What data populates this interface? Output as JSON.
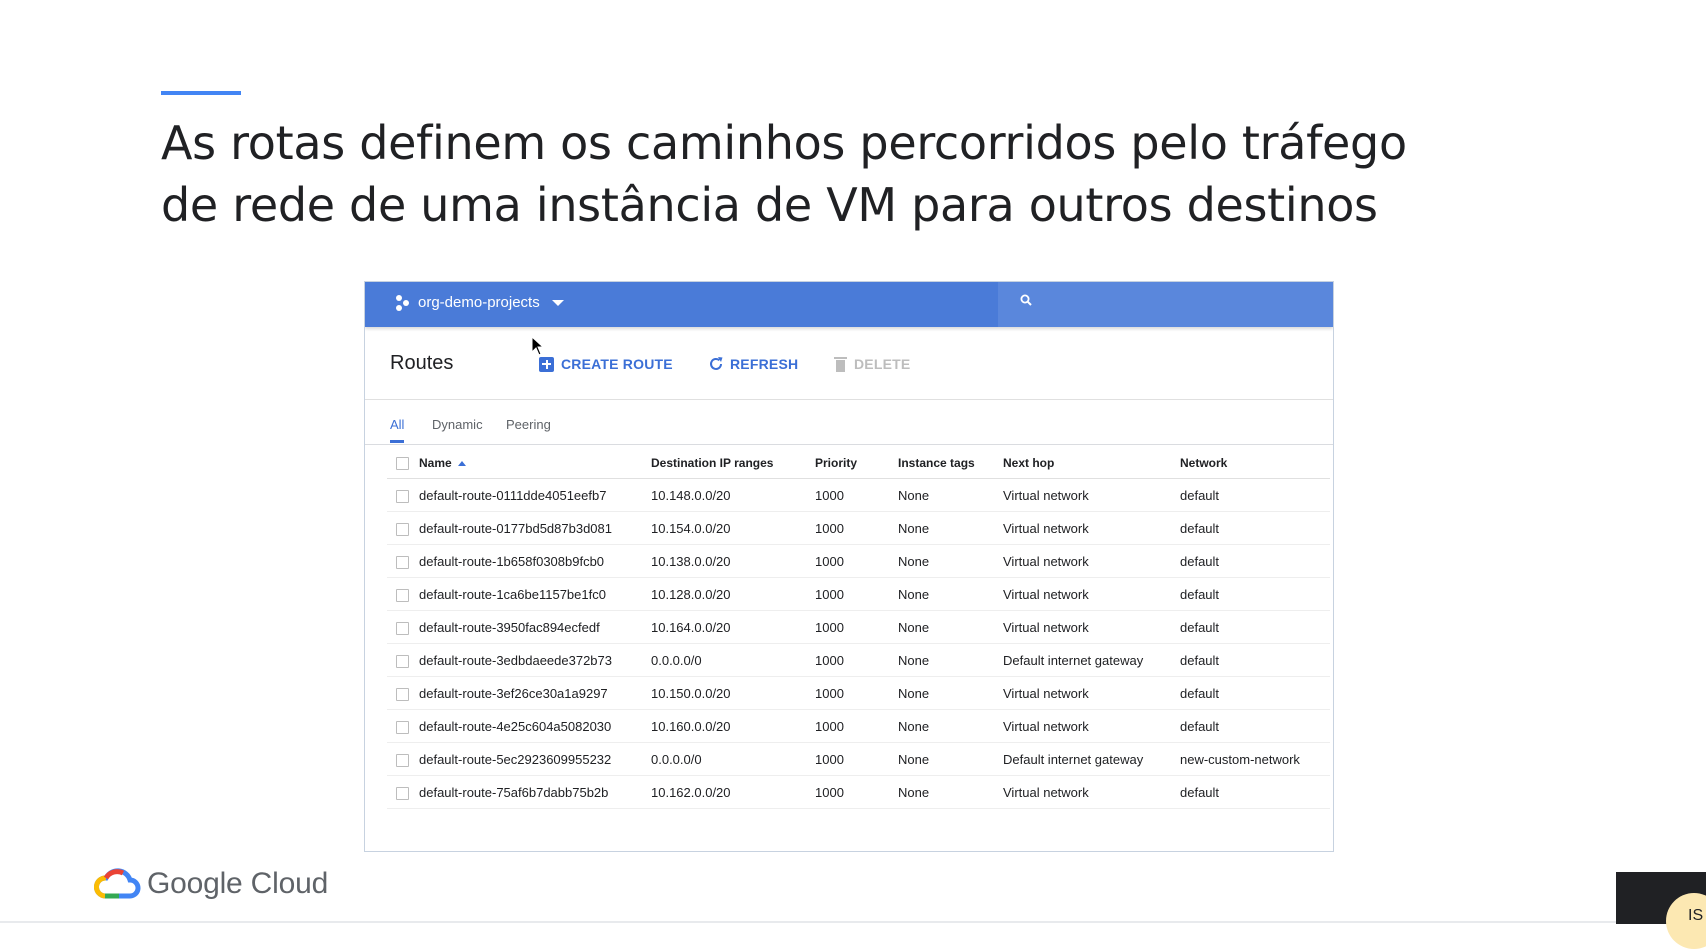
{
  "slide": {
    "title_line1": "As rotas definem os caminhos percorridos pelo tráfego",
    "title_line2": "de rede de uma instância de VM para outros destinos",
    "accent_color": "#4285f4"
  },
  "console": {
    "project_name": "org-demo-projects",
    "header_color": "#4a7bd8",
    "page_title": "Routes",
    "toolbar": {
      "create_label": "CREATE ROUTE",
      "refresh_label": "REFRESH",
      "delete_label": "DELETE"
    },
    "tabs": [
      "All",
      "Dynamic",
      "Peering"
    ],
    "active_tab": "All",
    "columns": [
      "Name",
      "Destination IP ranges",
      "Priority",
      "Instance tags",
      "Next hop",
      "Network"
    ],
    "rows": [
      {
        "name": "default-route-0111dde4051eefb7",
        "dest": "10.148.0.0/20",
        "priority": "1000",
        "tags": "None",
        "hop": "Virtual network",
        "network": "default"
      },
      {
        "name": "default-route-0177bd5d87b3d081",
        "dest": "10.154.0.0/20",
        "priority": "1000",
        "tags": "None",
        "hop": "Virtual network",
        "network": "default"
      },
      {
        "name": "default-route-1b658f0308b9fcb0",
        "dest": "10.138.0.0/20",
        "priority": "1000",
        "tags": "None",
        "hop": "Virtual network",
        "network": "default"
      },
      {
        "name": "default-route-1ca6be1157be1fc0",
        "dest": "10.128.0.0/20",
        "priority": "1000",
        "tags": "None",
        "hop": "Virtual network",
        "network": "default"
      },
      {
        "name": "default-route-3950fac894ecfedf",
        "dest": "10.164.0.0/20",
        "priority": "1000",
        "tags": "None",
        "hop": "Virtual network",
        "network": "default"
      },
      {
        "name": "default-route-3edbdaeede372b73",
        "dest": "0.0.0.0/0",
        "priority": "1000",
        "tags": "None",
        "hop": "Default internet gateway",
        "network": "default"
      },
      {
        "name": "default-route-3ef26ce30a1a9297",
        "dest": "10.150.0.0/20",
        "priority": "1000",
        "tags": "None",
        "hop": "Virtual network",
        "network": "default"
      },
      {
        "name": "default-route-4e25c604a5082030",
        "dest": "10.160.0.0/20",
        "priority": "1000",
        "tags": "None",
        "hop": "Virtual network",
        "network": "default"
      },
      {
        "name": "default-route-5ec2923609955232",
        "dest": "0.0.0.0/0",
        "priority": "1000",
        "tags": "None",
        "hop": "Default internet gateway",
        "network": "new-custom-network"
      },
      {
        "name": "default-route-75af6b7dabb75b2b",
        "dest": "10.162.0.0/20",
        "priority": "1000",
        "tags": "None",
        "hop": "Virtual network",
        "network": "default"
      }
    ]
  },
  "branding": {
    "logo_text": "Google Cloud"
  },
  "avatar": {
    "initials": "IS"
  }
}
